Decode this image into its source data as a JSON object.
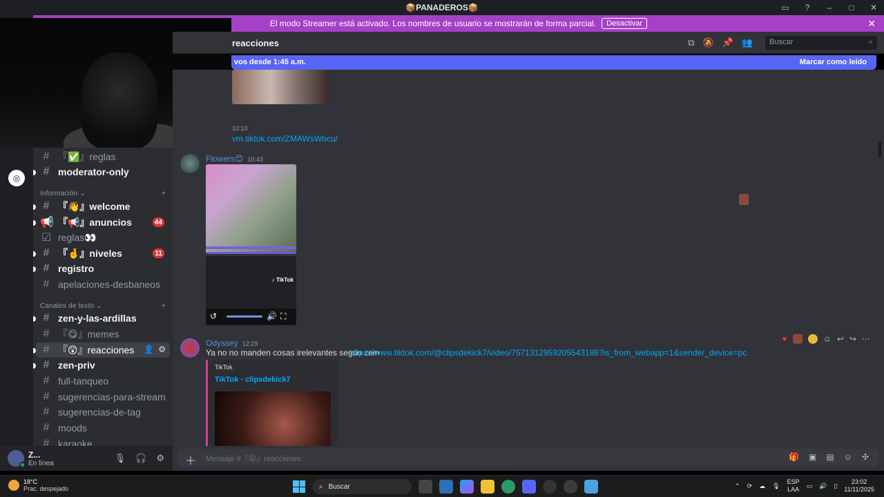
{
  "window": {
    "title": "📦PANADEROS📦"
  },
  "banner": {
    "text": "El modo Streamer está activado. Los nombres de usuario se mostrarán de forma parcial.",
    "button": "Desactivar",
    "close": "✕"
  },
  "header": {
    "channel": "reacciones",
    "search_placeholder": "Buscar"
  },
  "newbar": {
    "left": "vos desde 1:45 a.m.",
    "right": "Marcar como leído"
  },
  "sidebar": {
    "categories": [
      {
        "label": "Información ⌄"
      },
      {
        "label": "Canales de texto ⌄"
      }
    ],
    "channels": [
      {
        "name": "『✅』reglas"
      },
      {
        "name": "moderator-only"
      },
      {
        "name": "『👋』welcome"
      },
      {
        "name": "『📢』anuncios",
        "badge": "44"
      },
      {
        "name": "reglas👀"
      },
      {
        "name": "『🤞』niveles",
        "badge": "11"
      },
      {
        "name": "registro"
      },
      {
        "name": "apelaciones-desbaneos"
      },
      {
        "name": "zen-y-las-ardillas"
      },
      {
        "name": "『😋』memes"
      },
      {
        "name": "『😲』reacciones"
      },
      {
        "name": "zen-priv"
      },
      {
        "name": "full-tanqueo"
      },
      {
        "name": "sugerencias-para-stream"
      },
      {
        "name": "sugerencias-de-tag"
      },
      {
        "name": "moods"
      },
      {
        "name": "karaoke"
      }
    ]
  },
  "user": {
    "name": "Z...",
    "status": "En línea"
  },
  "messages": {
    "top_time": "10:10",
    "top_link": "vm.tiktok.com/ZMAWsWbcu/",
    "flowers": {
      "name": "Flowers😊",
      "time": "10:43"
    },
    "tiktok_label": "♪ TikTok",
    "odyssey": {
      "name": "Odyssey",
      "time": "12:29",
      "text": "Ya no no manden cosas irelevantes según zein",
      "link": "https://www.tiktok.com/@clipsdekick7/video/7571312959205543186?is_from_webapp=1&sender_device=pc",
      "embed_provider": "TikTok",
      "embed_title": "TikTok · clipsdekick7"
    }
  },
  "composer": {
    "placeholder": "Mensaje #『😲』reacciones"
  },
  "taskbar": {
    "temp": "18°C",
    "weather": "Prac. despejado",
    "search": "Buscar",
    "lang1": "ESP",
    "lang2": "LAA",
    "time": "23:02",
    "date": "11/11/2025"
  }
}
